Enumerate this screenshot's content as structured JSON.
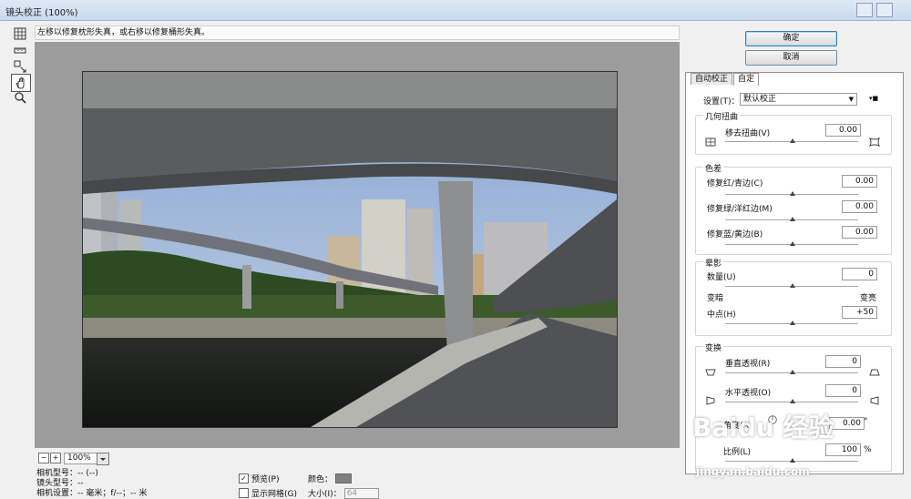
{
  "window": {
    "title": "镜头校正 (100%)"
  },
  "hint": "左移以修复枕形失真，或右移以修复桶形失真。",
  "tools": [
    "remove-distortion-tool",
    "straighten-tool",
    "move-grid-tool",
    "hand-tool",
    "zoom-tool"
  ],
  "zoom": {
    "minus": "−",
    "plus": "+",
    "value": "100%"
  },
  "info": {
    "camera_model": "相机型号：-- (--)",
    "lens_model": "镜头型号：--",
    "camera_settings": "相机设置：-- 毫米；f/--；-- 米"
  },
  "options": {
    "preview_label": "预览(P)",
    "preview_checked": true,
    "color_label": "颜色：",
    "color": "#808080",
    "grid_label": "显示网格(G)",
    "grid_checked": false,
    "size_label": "大小(I)：",
    "size_value": "64"
  },
  "buttons": {
    "ok": "确定",
    "cancel": "取消"
  },
  "tabs": [
    "自动校正",
    "自定"
  ],
  "settings": {
    "label": "设置(T)：",
    "value": "默认校正"
  },
  "geometric": {
    "title": "几何扭曲",
    "remove_distortion_label": "移去扭曲(V)",
    "remove_distortion_value": "0.00"
  },
  "chromatic": {
    "title": "色差",
    "red_cyan_label": "修复红/青边(C)",
    "red_cyan_value": "0.00",
    "green_magenta_label": "修复绿/洋红边(M)",
    "green_magenta_value": "0.00",
    "blue_yellow_label": "修复蓝/黄边(B)",
    "blue_yellow_value": "0.00"
  },
  "vignette": {
    "title": "晕影",
    "amount_label": "数量(U)",
    "amount_value": "0",
    "darken_label": "变暗",
    "lighten_label": "变亮",
    "midpoint_label": "中点(H)",
    "midpoint_value": "+50"
  },
  "transform": {
    "title": "变换",
    "vertical_label": "垂直透视(R)",
    "vertical_value": "0",
    "horizontal_label": "水平透视(O)",
    "horizontal_value": "0",
    "angle_label": "角度(A)",
    "angle_value": "0.00",
    "angle_unit": "°",
    "scale_label": "比例(L)",
    "scale_value": "100",
    "scale_unit": "%"
  },
  "watermark": {
    "logo": "Baidu 经验",
    "url": "jingyan.baidu.com"
  }
}
